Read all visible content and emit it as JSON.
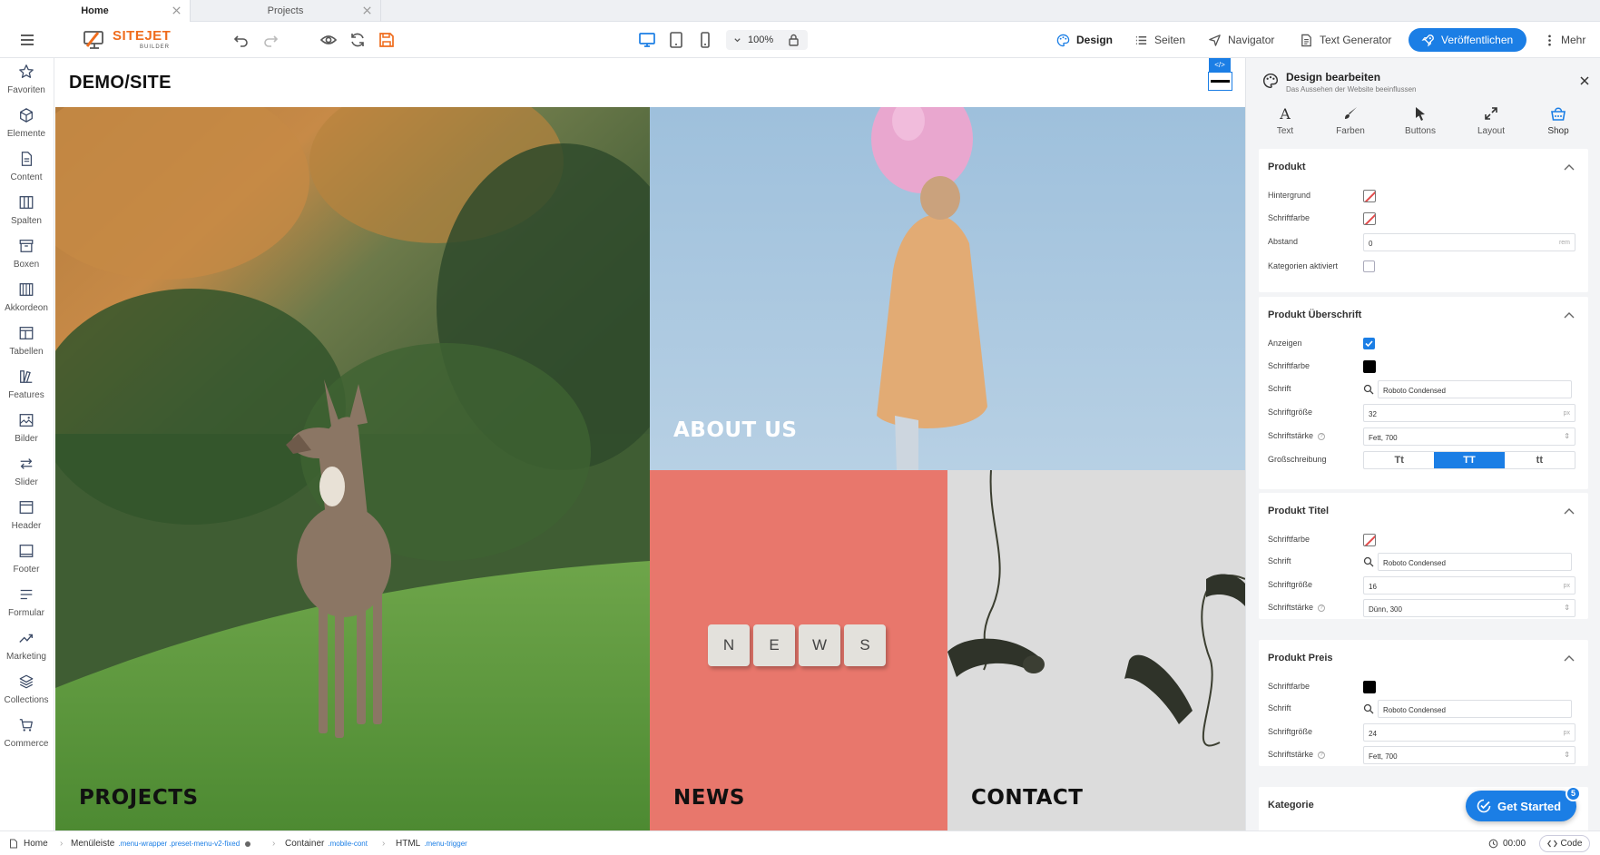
{
  "tabs": [
    {
      "label": "Home",
      "active": true
    },
    {
      "label": "Projects",
      "active": false
    }
  ],
  "toolbar": {
    "logo_main": "SITEJET",
    "logo_sub": "BUILDER",
    "zoom": "100%",
    "design_label": "Design",
    "pages_label": "Seiten",
    "navigator_label": "Navigator",
    "textgen_label": "Text Generator",
    "publish_label": "Veröffentlichen",
    "more_label": "Mehr"
  },
  "sidebar": {
    "items": [
      {
        "label": "Favoriten",
        "icon": "star-icon"
      },
      {
        "label": "Elemente",
        "icon": "cube-icon"
      },
      {
        "label": "Content",
        "icon": "file-icon"
      },
      {
        "label": "Spalten",
        "icon": "columns-icon"
      },
      {
        "label": "Boxen",
        "icon": "box-icon"
      },
      {
        "label": "Akkordeon",
        "icon": "accordion-icon"
      },
      {
        "label": "Tabellen",
        "icon": "table-icon"
      },
      {
        "label": "Features",
        "icon": "features-icon"
      },
      {
        "label": "Bilder",
        "icon": "image-icon"
      },
      {
        "label": "Slider",
        "icon": "slider-icon"
      },
      {
        "label": "Header",
        "icon": "header-icon"
      },
      {
        "label": "Footer",
        "icon": "footer-icon"
      },
      {
        "label": "Formular",
        "icon": "form-icon"
      },
      {
        "label": "Marketing",
        "icon": "marketing-icon"
      },
      {
        "label": "Collections",
        "icon": "collections-icon"
      },
      {
        "label": "Commerce",
        "icon": "cart-icon"
      }
    ]
  },
  "canvas": {
    "site_title": "DEMO/SITE",
    "code_badge": "</>",
    "tiles": {
      "projects": "PROJECTS",
      "about": "ABOUT US",
      "news": "NEWS",
      "contact": "CONTACT"
    },
    "news_letters": [
      "N",
      "E",
      "W",
      "S"
    ]
  },
  "panel": {
    "title": "Design bearbeiten",
    "subtitle": "Das Aussehen der Website beeinflussen",
    "tabs": [
      {
        "label": "Text",
        "icon": "text-icon"
      },
      {
        "label": "Farben",
        "icon": "brush-icon"
      },
      {
        "label": "Buttons",
        "icon": "cursor-icon"
      },
      {
        "label": "Layout",
        "icon": "expand-icon"
      },
      {
        "label": "Shop",
        "icon": "basket-icon"
      }
    ],
    "produkt": {
      "header": "Produkt",
      "bg_label": "Hintergrund",
      "color_label": "Schriftfarbe",
      "spacing_label": "Abstand",
      "spacing_value": "0",
      "spacing_unit": "rem",
      "categories_label": "Kategorien aktiviert"
    },
    "ueberschrift": {
      "header": "Produkt Überschrift",
      "show_label": "Anzeigen",
      "color_label": "Schriftfarbe",
      "font_label": "Schrift",
      "font_value": "Roboto Condensed",
      "size_label": "Schriftgröße",
      "size_value": "32",
      "size_unit": "px",
      "weight_label": "Schriftstärke",
      "weight_value": "Fett, 700",
      "case_label": "Großschreibung",
      "case_options": [
        "Tt",
        "TT",
        "tt"
      ]
    },
    "titel": {
      "header": "Produkt Titel",
      "color_label": "Schriftfarbe",
      "font_label": "Schrift",
      "font_value": "Roboto Condensed",
      "size_label": "Schriftgröße",
      "size_value": "16",
      "size_unit": "px",
      "weight_label": "Schriftstärke",
      "weight_value": "Dünn, 300"
    },
    "preis": {
      "header": "Produkt Preis",
      "color_label": "Schriftfarbe",
      "font_label": "Schrift",
      "font_value": "Roboto Condensed",
      "size_label": "Schriftgröße",
      "size_value": "24",
      "size_unit": "px",
      "weight_label": "Schriftstärke",
      "weight_value": "Fett, 700"
    },
    "kategorie": {
      "header": "Kategorie"
    },
    "get_started": "Get Started",
    "badge_count": "5"
  },
  "bottombar": {
    "crumbs": [
      {
        "label": "Home",
        "cls": ""
      },
      {
        "label": "Menüleiste",
        "cls": ".menu-wrapper .preset-menu-v2-fixed"
      },
      {
        "label": "Container",
        "cls": ".mobile-cont"
      },
      {
        "label": "HTML",
        "cls": ".menu-trigger"
      }
    ],
    "time": "00:00",
    "code_label": "Code"
  },
  "colors": {
    "accent": "#1b7ee5",
    "logo_orange": "#ef6c1d",
    "news_bg": "#e8776c",
    "about_bg": "#9fc1dc"
  }
}
